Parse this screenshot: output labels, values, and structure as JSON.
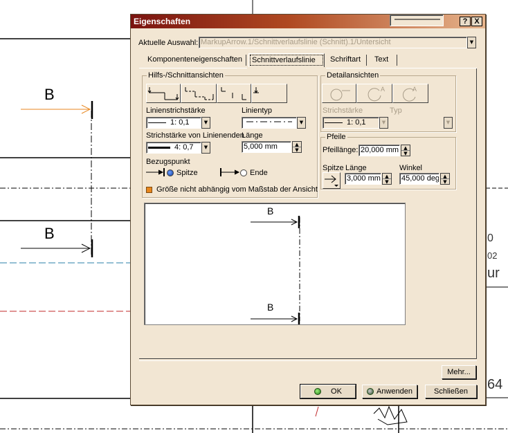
{
  "background": {
    "labels": [
      {
        "text": "B"
      },
      {
        "text": "B"
      }
    ],
    "partial_texts": [
      {
        "text": "0"
      },
      {
        "text": "02"
      },
      {
        "text": "ur"
      },
      {
        "text": "64"
      }
    ]
  },
  "dialog": {
    "title": "Eigenschaften",
    "help_glyph": "?",
    "close_glyph": "X",
    "current_selection_label": "Aktuelle Auswahl:",
    "current_selection_value": "MarkupArrow.1/Schnittverlaufslinie (Schnitt).1/Untersicht",
    "tabs": [
      {
        "label": "Komponenteneigenschaften",
        "active": false
      },
      {
        "label": "Schnittverlaufslinie",
        "active": true
      },
      {
        "label": "Schriftart",
        "active": false
      },
      {
        "label": "Text",
        "active": false
      }
    ],
    "aux_group": {
      "title": "Hilfs-/Schnittansichten",
      "line_width_label": "Linienstrichstärke",
      "line_width_value": "1: 0,1",
      "line_type_label": "Linientyp",
      "end_width_label": "Strichstärke von Linienenden",
      "end_width_value": "4: 0,7",
      "length_label": "Länge",
      "length_value": "5,000 mm",
      "anchor_label": "Bezugspunkt",
      "anchor_tip_label": "Spitze",
      "anchor_end_label": "Ende",
      "scale_checkbox_label": "Größe nicht abhängig vom Maßstab der Ansicht"
    },
    "detail_group": {
      "title": "Detailansichten",
      "stroke_label": "Strichstärke",
      "stroke_value": "1: 0,1",
      "type_label": "Typ"
    },
    "arrows_group": {
      "title": "Pfeile",
      "arrow_length_label": "Pfeillänge:",
      "arrow_length_value": "20,000 mm",
      "tip_label": "Spitze",
      "length_label": "Länge",
      "length_value": "3,000 mm",
      "angle_label": "Winkel",
      "angle_value": "45,000 deg"
    },
    "preview": {
      "label_top": "B",
      "label_bottom": "B"
    },
    "buttons": {
      "more": "Mehr...",
      "ok": "OK",
      "apply": "Anwenden",
      "close": "Schließen"
    }
  },
  "colors": {
    "dialog_bg": "#f2e6d3",
    "title_start": "#7a1410",
    "orange_arrow": "#e8861c"
  }
}
